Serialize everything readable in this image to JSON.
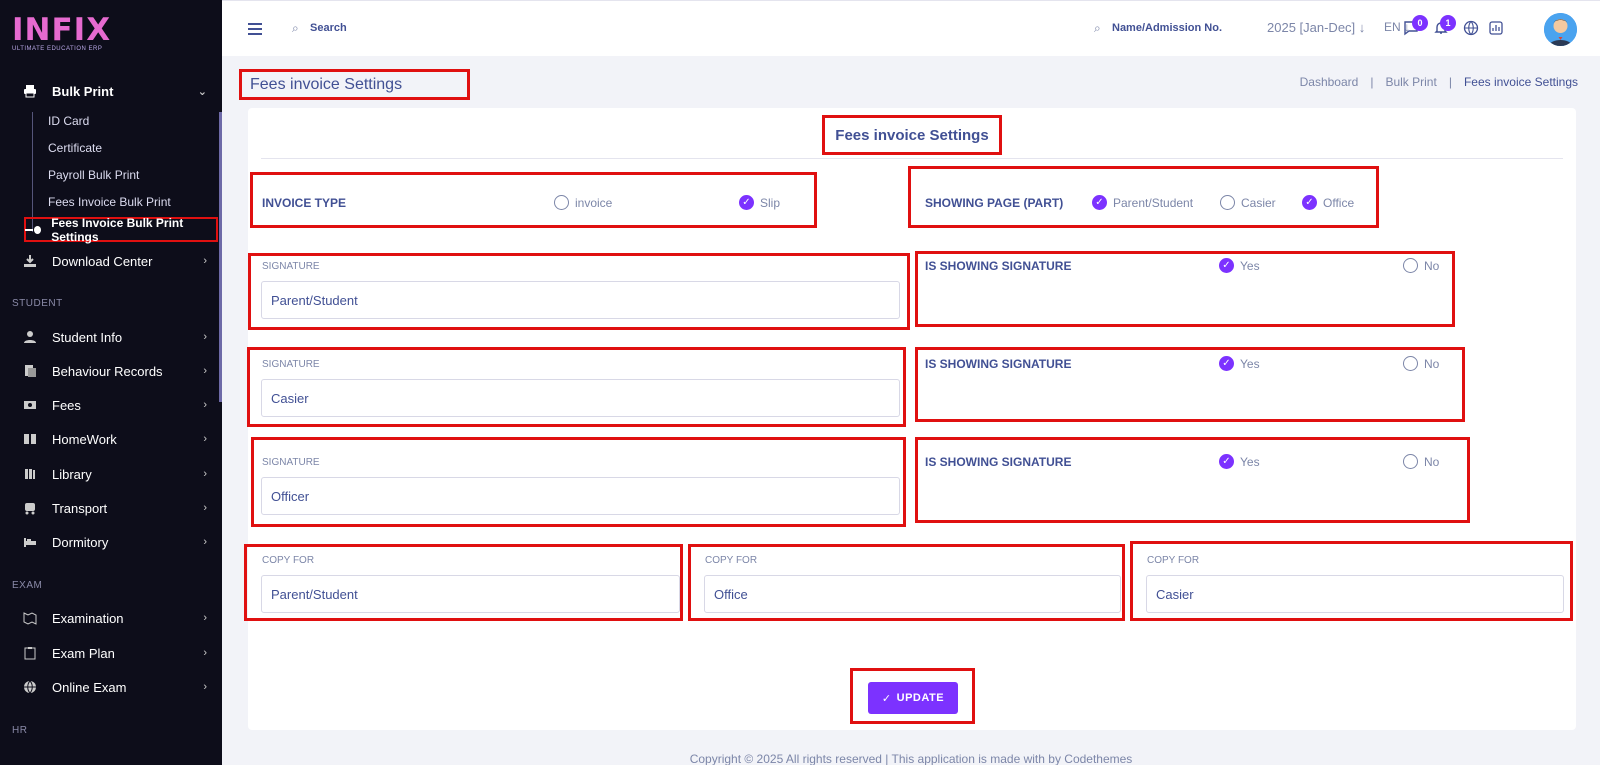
{
  "brand": {
    "logo": "INFIX",
    "tagline": "ULTIMATE EDUCATION ERP"
  },
  "sidebar": {
    "bulk_print": "Bulk Print",
    "sub_items": [
      "ID Card",
      "Certificate",
      "Payroll Bulk Print",
      "Fees Invoice Bulk Print",
      "Fees Invoice Bulk Print Settings"
    ],
    "download_center": "Download Center",
    "section_student": "STUDENT",
    "student_items": [
      "Student Info",
      "Behaviour Records",
      "Fees",
      "HomeWork",
      "Library",
      "Transport",
      "Dormitory"
    ],
    "section_exam": "EXAM",
    "exam_items": [
      "Examination",
      "Exam Plan",
      "Online Exam"
    ],
    "section_hr": "HR"
  },
  "topbar": {
    "search": "Search",
    "search_student": "Name/Admission No.",
    "session": "2025 [Jan-Dec]",
    "lang": "EN",
    "messages_count": "0",
    "notifications_count": "1"
  },
  "page": {
    "title": "Fees invoice Settings",
    "breadcrumb": [
      "Dashboard",
      "Bulk Print",
      "Fees invoice Settings"
    ]
  },
  "form": {
    "card_title": "Fees invoice Settings",
    "invoice_type_label": "INVOICE TYPE",
    "invoice_options": [
      {
        "label": "invoice",
        "checked": false
      },
      {
        "label": "Slip",
        "checked": true
      }
    ],
    "showing_page_label": "SHOWING PAGE (PART)",
    "showing_page_options": [
      {
        "label": "Parent/Student",
        "checked": true
      },
      {
        "label": "Casier",
        "checked": false
      },
      {
        "label": "Office",
        "checked": true
      }
    ],
    "signatures": [
      {
        "label": "SIGNATURE",
        "value": "Parent/Student",
        "show_label": "IS SHOWING SIGNATURE",
        "yes": "Yes",
        "no": "No",
        "selected": "Yes"
      },
      {
        "label": "SIGNATURE",
        "value": "Casier",
        "show_label": "IS SHOWING SIGNATURE",
        "yes": "Yes",
        "no": "No",
        "selected": "Yes"
      },
      {
        "label": "SIGNATURE",
        "value": "Officer",
        "show_label": "IS SHOWING SIGNATURE",
        "yes": "Yes",
        "no": "No",
        "selected": "Yes"
      }
    ],
    "copies": [
      {
        "label": "COPY FOR",
        "value": "Parent/Student"
      },
      {
        "label": "COPY FOR",
        "value": "Office"
      },
      {
        "label": "COPY FOR",
        "value": "Casier"
      }
    ],
    "update_button": "UPDATE"
  },
  "footer": "Copyright © 2025 All rights reserved | This application is made with by Codethemes",
  "colors": {
    "accent": "#7c32ff",
    "sidebar_bg": "#0d0d1a",
    "highlight": "#e01010",
    "text": "#415094"
  }
}
